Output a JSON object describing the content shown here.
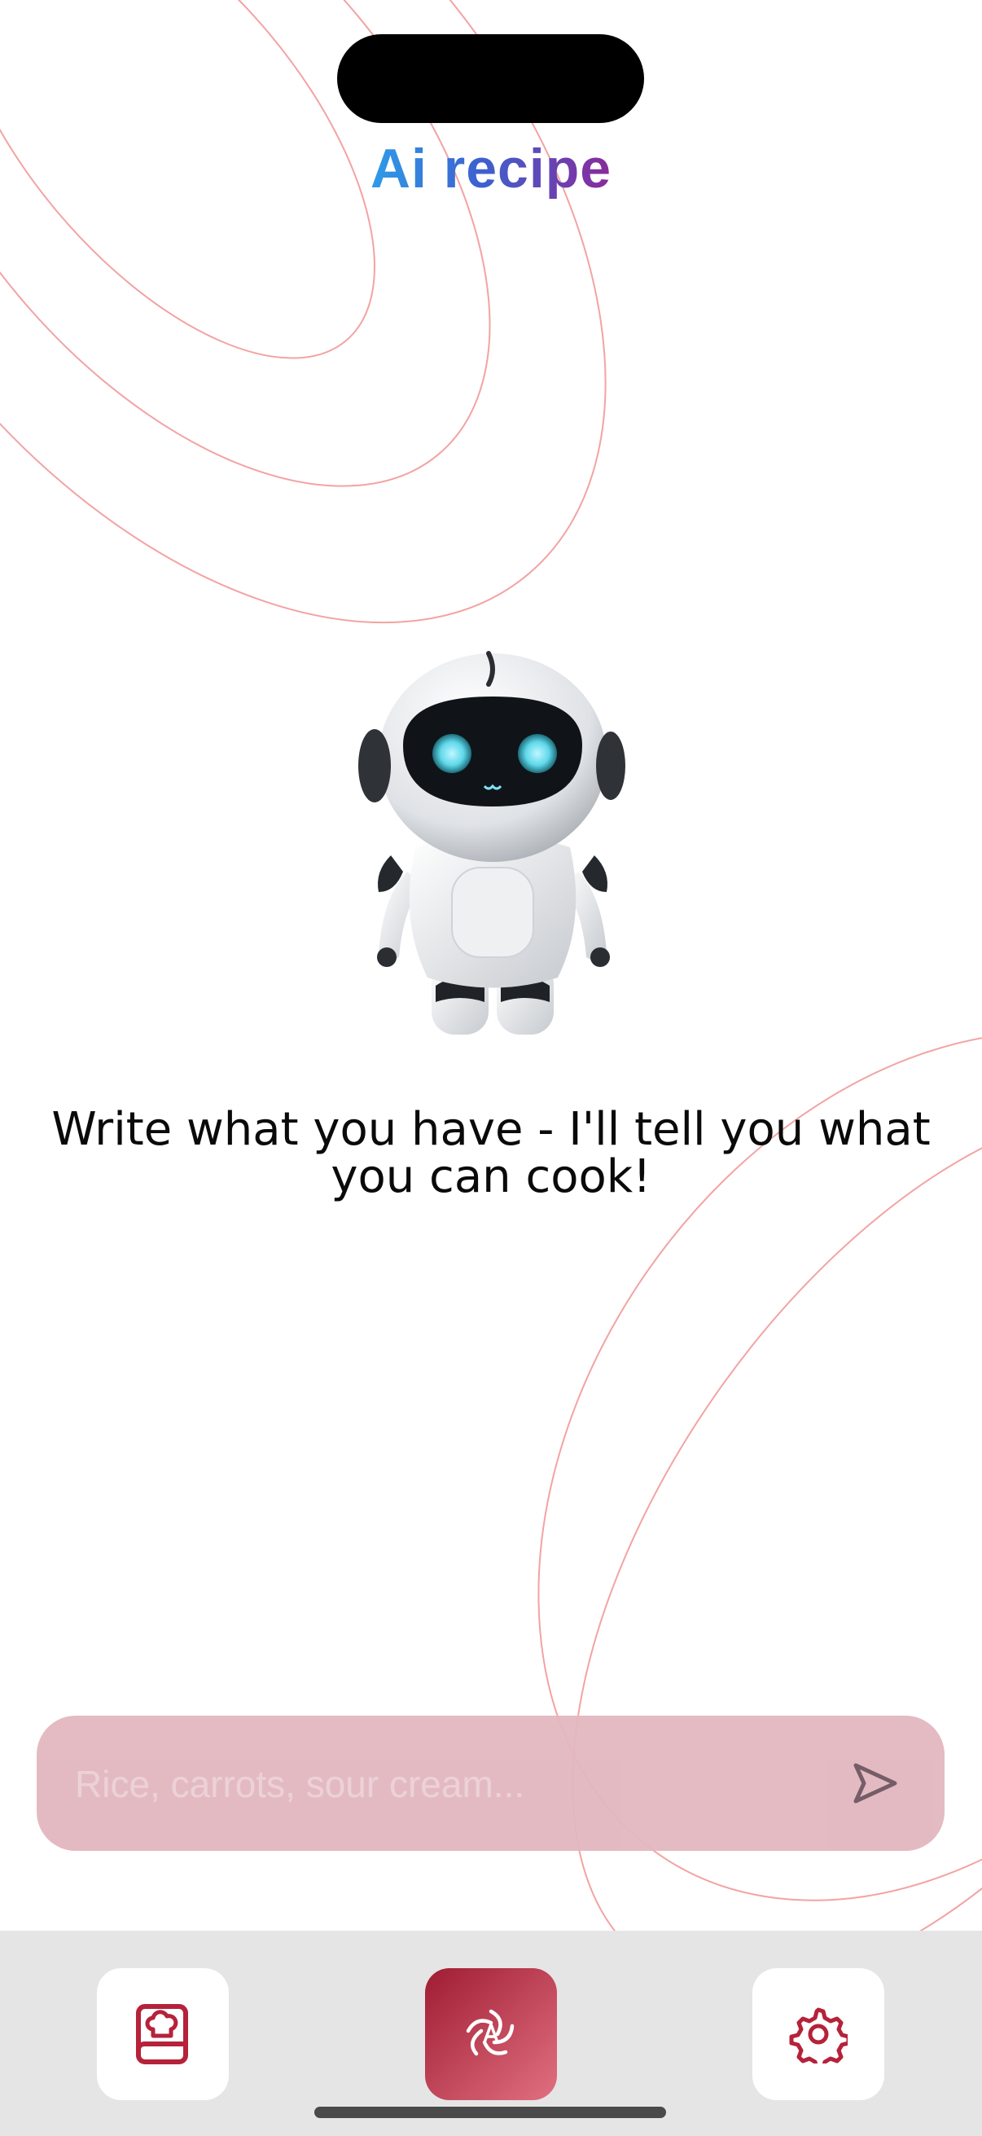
{
  "app": {
    "title": "Ai recipe"
  },
  "hero": {
    "message": "Write what you have - I'll tell you what you can cook!"
  },
  "chat_input": {
    "placeholder": "Rice, carrots, sour cream...",
    "value": ""
  },
  "tabbar": {
    "items": [
      {
        "id": "recipes",
        "icon": "recipe-book-icon"
      },
      {
        "id": "ai",
        "icon": "ai-swirl-icon",
        "active": true
      },
      {
        "id": "settings",
        "icon": "gear-icon"
      }
    ]
  },
  "colors": {
    "accent": "#b5223a",
    "input_bg": "#e3b7bf",
    "decor_lines": "#f3a3a3",
    "tabbar_bg": "#e5e5e5"
  }
}
